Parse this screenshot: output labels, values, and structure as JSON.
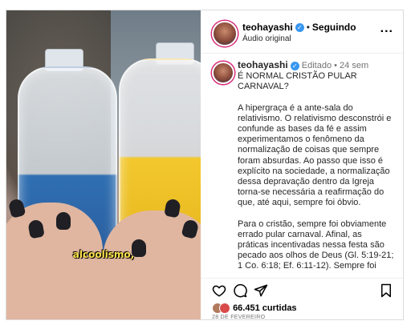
{
  "header": {
    "username": "teohayashi",
    "separator": "•",
    "follow_status": "Seguindo",
    "audio": "Áudio original",
    "more": "..."
  },
  "post": {
    "username": "teohayashi",
    "edited_meta": "Editado • 24 sem",
    "title": "É NORMAL CRISTÃO PULAR CARNAVAL?",
    "paragraph1": "A hipergraça é a ante-sala do relativismo. O relativismo desconstrói e confunde as bases da fé e assim experimentamos o fenômeno da normalização de coisas que sempre foram absurdas. Ao passo que isso é explícito na sociedade, a normalização dessa depravação dentro da Igreja torna-se necessária a reafirmação do que, até aqui, sempre foi óbvio.",
    "paragraph2": "Para o cristão, sempre foi obviamente errado pular carnaval. Afinal, as práticas incentivadas nessa festa são pecado aos olhos de Deus (Gl. 5:19-21; 1 Co. 6:18; Ef. 6:11-12). Sempre foi"
  },
  "media": {
    "caption": "alcoolismo,"
  },
  "actions": {
    "icons": [
      "heart-icon",
      "comment-icon",
      "share-icon",
      "bookmark-icon"
    ],
    "likes": "66.451 curtidas",
    "date": "28 DE FEVEREIRO"
  },
  "colors": {
    "verified": "#3897f0",
    "caption": "#ffe34d",
    "meta_gray": "#737373"
  }
}
